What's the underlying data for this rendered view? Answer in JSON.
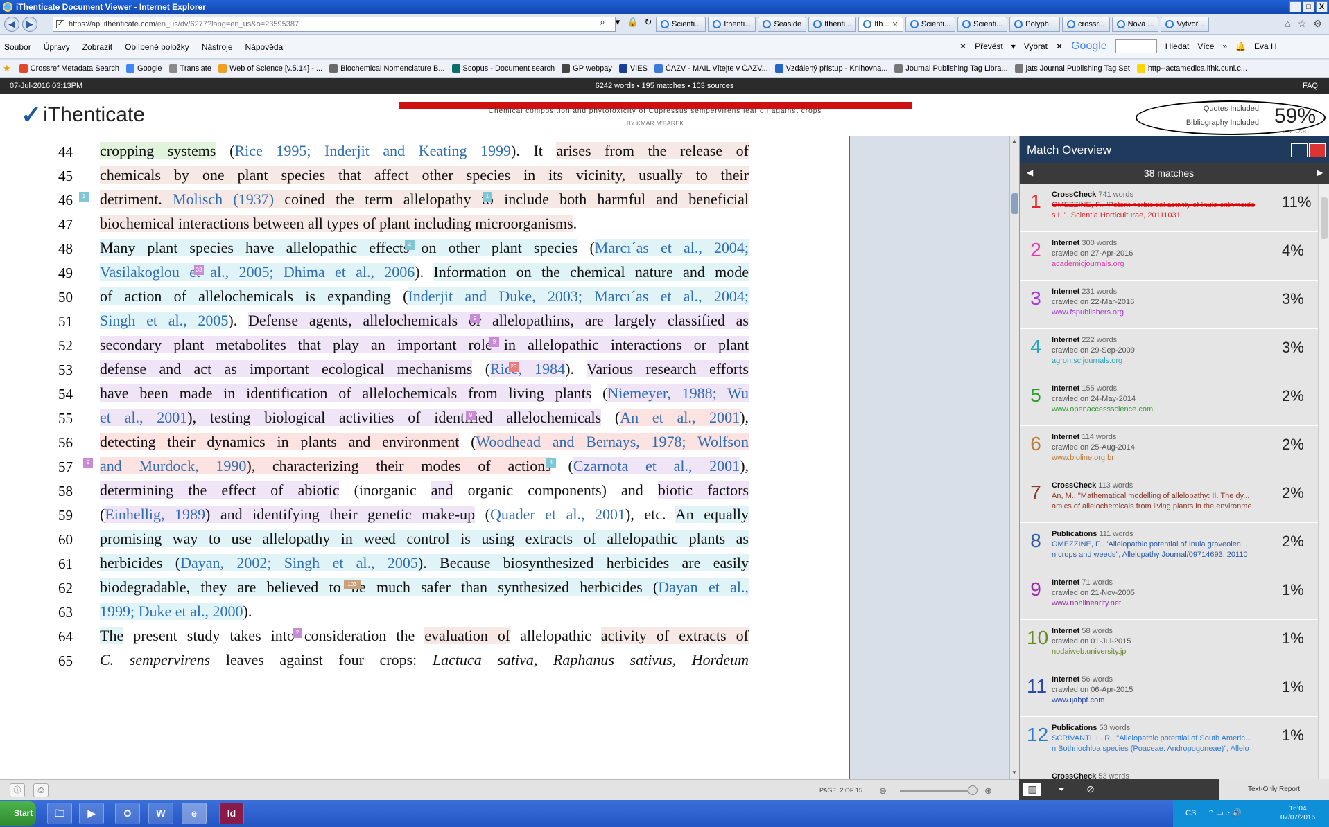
{
  "window": {
    "title": "iThenticate Document Viewer - Internet Explorer",
    "min": "_",
    "max": "□",
    "close": "X"
  },
  "address": {
    "url_main": "https://api.ithenticate.com",
    "url_rest": "/en_us/dv/6277?lang=en_us&o=23595387"
  },
  "tabs": [
    {
      "label": "Scienti..."
    },
    {
      "label": "Ithenti..."
    },
    {
      "label": "Seaside"
    },
    {
      "label": "Ithenti..."
    },
    {
      "label": "Ith..."
    },
    {
      "label": "Scienti..."
    },
    {
      "label": "Scienti..."
    },
    {
      "label": "Polyph..."
    },
    {
      "label": "crossr..."
    },
    {
      "label": "Nová ..."
    },
    {
      "label": "Vytvoř..."
    }
  ],
  "menu": [
    "Soubor",
    "Úpravy",
    "Zobrazit",
    "Oblíbené položky",
    "Nástroje",
    "Nápověda"
  ],
  "commands": {
    "prevest": "Převést",
    "vybrat": "Vybrat",
    "google": "Google",
    "hledat": "Hledat",
    "vice": "Více",
    "user": "Eva H"
  },
  "favorites": [
    {
      "label": "Crossref Metadata Search",
      "color": "#e2472b"
    },
    {
      "label": "Google",
      "color": "#4285f4"
    },
    {
      "label": "Translate",
      "color": "#8a8a8a"
    },
    {
      "label": "Web of Science [v.5.14] - ...",
      "color": "#f0a020"
    },
    {
      "label": "Biochemical Nomenclature B...",
      "color": "#6a6a6a"
    },
    {
      "label": "Scopus - Document search",
      "color": "#0f6d6d"
    },
    {
      "label": "GP webpay",
      "color": "#444444"
    },
    {
      "label": "VIES",
      "color": "#1a3c9a"
    },
    {
      "label": "ČAZV - MAIL  Vítejte v ČAZV...",
      "color": "#3a7bd5"
    },
    {
      "label": "Vzdálený přístup - Knihovna...",
      "color": "#2266cc"
    },
    {
      "label": "Journal Publishing Tag Libra...",
      "color": "#777777"
    },
    {
      "label": "jats Journal Publishing Tag Set",
      "color": "#777777"
    },
    {
      "label": "http--actamedica.lfhk.cuni.c...",
      "color": "#ffd400"
    }
  ],
  "infobar": {
    "date": "07-Jul-2016 03:13PM",
    "stats": "6242 words • 195 matches • 103 sources",
    "faq": "FAQ"
  },
  "header": {
    "logo_text": "iThenticate",
    "doc_title": "Chemical composition and phytotoxicity of Cupressus sempervirens leaf oil against crops",
    "author": "BY KMAR M'BAREK",
    "quotes": "Quotes Included",
    "bibliography": "Bibliography Included",
    "similarity": "59%",
    "similarity_label": "SIMILAR"
  },
  "lines": [
    {
      "n": "44",
      "parts": [
        [
          "cropping systems",
          "green",
          ""
        ],
        [
          " (",
          "",
          ""
        ],
        [
          "Rice 1995; Inderjit and Keating 1999",
          "",
          "cite"
        ],
        [
          "). It ",
          "",
          ""
        ],
        [
          "arises from the release of",
          "pink",
          ""
        ]
      ]
    },
    {
      "n": "45",
      "parts": [
        [
          "chemicals by one plant species that affect other species in its vicinity, usually to their",
          "pink",
          ""
        ]
      ]
    },
    {
      "n": "46",
      "parts": [
        [
          "detriment. ",
          "pink",
          ""
        ],
        [
          "Molisch (1937)",
          "pink",
          "cite"
        ],
        [
          " coined the term allelopathy to include both harmful and beneficial",
          "pink",
          ""
        ]
      ]
    },
    {
      "n": "47",
      "nojust": true,
      "parts": [
        [
          "biochemical interactions between all types of plant including microorganisms",
          "pink",
          ""
        ],
        [
          ".",
          "",
          ""
        ]
      ]
    },
    {
      "n": "48",
      "parts": [
        [
          "Many plant species have allelopathic effects on other plant species",
          "cyan",
          ""
        ],
        [
          " (",
          "",
          ""
        ],
        [
          "Marcı´as et al., 2004;",
          "cyan",
          "cite"
        ]
      ]
    },
    {
      "n": "49",
      "parts": [
        [
          "Vasilakoglou et al., 2005; Dhima et al., 2006",
          "cyan",
          "cite"
        ],
        [
          "). ",
          "",
          ""
        ],
        [
          "Information on the chemical nature and mode",
          "cyan",
          ""
        ]
      ]
    },
    {
      "n": "50",
      "parts": [
        [
          "of action of allelochemicals is expanding",
          "cyan",
          ""
        ],
        [
          " (",
          "",
          ""
        ],
        [
          "Inderjit and Duke, 2003; Marcı´as et al., 2004;",
          "cyan",
          "cite"
        ]
      ]
    },
    {
      "n": "51",
      "parts": [
        [
          "Singh et al., 2005",
          "cyan",
          "cite"
        ],
        [
          "). ",
          "",
          ""
        ],
        [
          "Defense agents, allelochemicals or allelopathins, are largely classified as",
          "lilac",
          ""
        ]
      ]
    },
    {
      "n": "52",
      "parts": [
        [
          "secondary plant metabolites that play an important role in allelopathic interactions or plant",
          "lilac",
          ""
        ]
      ]
    },
    {
      "n": "53",
      "parts": [
        [
          "defense and act as important ecological mechanisms",
          "lilac",
          ""
        ],
        [
          " (",
          "",
          ""
        ],
        [
          "Rice, 1984",
          "lilac",
          "cite"
        ],
        [
          "). ",
          "",
          ""
        ],
        [
          "Various research efforts",
          "lilac",
          ""
        ]
      ]
    },
    {
      "n": "54",
      "parts": [
        [
          "have been made in identification of allelochemicals from living plants",
          "lilac",
          ""
        ],
        [
          " (",
          "",
          ""
        ],
        [
          "Niemeyer, 1988; Wu",
          "lilac",
          "cite"
        ]
      ]
    },
    {
      "n": "55",
      "parts": [
        [
          "et al., 2001",
          "lilac",
          "cite"
        ],
        [
          "), testing biological activities of identified allelochemicals",
          "lilac",
          ""
        ],
        [
          " (",
          "",
          ""
        ],
        [
          "An et al., 2001",
          "red",
          "cite"
        ],
        [
          "),",
          "",
          ""
        ]
      ]
    },
    {
      "n": "56",
      "parts": [
        [
          "detecting their dynamics in plants and environment",
          "red",
          ""
        ],
        [
          " (",
          "",
          ""
        ],
        [
          "Woodhead and Bernays, 1978; Wolfson",
          "red",
          "cite"
        ]
      ]
    },
    {
      "n": "57",
      "parts": [
        [
          "and Murdock, 1990",
          "red",
          "cite"
        ],
        [
          "), characterizing their modes of actions",
          "red",
          ""
        ],
        [
          " (",
          "",
          ""
        ],
        [
          "Czarnota et al., 2001",
          "lilac",
          "cite"
        ],
        [
          "),",
          "",
          ""
        ]
      ]
    },
    {
      "n": "58",
      "parts": [
        [
          "determining the effect of abiotic",
          "lilac",
          ""
        ],
        [
          " (inorganic ",
          "",
          ""
        ],
        [
          "and",
          "lilac",
          ""
        ],
        [
          " organic components) and ",
          "",
          ""
        ],
        [
          "biotic factors",
          "lilac",
          ""
        ]
      ]
    },
    {
      "n": "59",
      "parts": [
        [
          "(",
          "",
          ""
        ],
        [
          "Einhellig, 1989",
          "lilac",
          "cite"
        ],
        [
          ") and identifying their genetic make-up",
          "lilac",
          ""
        ],
        [
          " (",
          "",
          ""
        ],
        [
          "Quader et al., 2001",
          "",
          "cite"
        ],
        [
          "), etc. ",
          "",
          ""
        ],
        [
          "An equally",
          "cyan",
          ""
        ]
      ]
    },
    {
      "n": "60",
      "parts": [
        [
          "promising way to use allelopathy in weed control is using extracts of allelopathic plants as",
          "cyan",
          ""
        ]
      ]
    },
    {
      "n": "61",
      "parts": [
        [
          "herbicides (",
          "cyan",
          ""
        ],
        [
          "Dayan, 2002; Singh et al., 2005",
          "cyan",
          "cite"
        ],
        [
          "). Because biosynthesized herbicides are easily",
          "cyan",
          ""
        ]
      ]
    },
    {
      "n": "62",
      "parts": [
        [
          "biodegradable, they are believed to be much safer than synthesized herbicides (",
          "cyan",
          ""
        ],
        [
          "Dayan et al.,",
          "cyan",
          "cite"
        ]
      ]
    },
    {
      "n": "63",
      "nojust": true,
      "parts": [
        [
          "1999; Duke et al., 2000",
          "cyan",
          "cite"
        ],
        [
          ").",
          "",
          ""
        ]
      ]
    },
    {
      "n": "64",
      "parts": [
        [
          "The",
          "cyan",
          ""
        ],
        [
          " present study takes into consideration the ",
          "",
          ""
        ],
        [
          "evaluation of",
          "pink",
          ""
        ],
        [
          " allelopathic ",
          "",
          ""
        ],
        [
          "activity of extracts of",
          "pink",
          ""
        ]
      ]
    },
    {
      "n": "65",
      "parts": [
        [
          "C. sempervirens",
          "",
          "ital"
        ],
        [
          " leaves against four crops: ",
          "",
          ""
        ],
        [
          "Lactuca sativa, Raphanus sativus, Hordeum",
          "",
          "ital"
        ]
      ]
    }
  ],
  "markers": {
    "m1": "1",
    "m2": "1",
    "m3": "4",
    "m4": "33",
    "m5": "9",
    "m6": "9",
    "m7": "23",
    "m8": "9",
    "m9": "9",
    "m10": "4",
    "m11": "103",
    "m12": "2"
  },
  "panel": {
    "title": "Match Overview",
    "count": "38 matches",
    "prev": "◀",
    "next": "▶"
  },
  "matches": [
    {
      "n": "1",
      "type": "CrossCheck",
      "words": "741 words",
      "line2": "OMEZZINE, F.. \"Potent herbicidal activity of Inula crithmoide",
      "line3": "s L.\", Scientia Horticulturae, 20111031",
      "pct": "11%",
      "color": "#e0262b",
      "strike": true
    },
    {
      "n": "2",
      "type": "Internet",
      "words": "300 words",
      "line2": "crawled on 27-Apr-2016",
      "line3": "academicjournals.org",
      "pct": "4%",
      "color": "#e03ab0"
    },
    {
      "n": "3",
      "type": "Internet",
      "words": "231 words",
      "line2": "crawled on 22-Mar-2016",
      "line3": "www.fspublishers.org",
      "pct": "3%",
      "color": "#a53ad6"
    },
    {
      "n": "4",
      "type": "Internet",
      "words": "222 words",
      "line2": "crawled on 29-Sep-2009",
      "line3": "agron.scijournals.org",
      "pct": "3%",
      "color": "#2aa6b8"
    },
    {
      "n": "5",
      "type": "Internet",
      "words": "155 words",
      "line2": "crawled on 24-May-2014",
      "line3": "www.openaccessscience.com",
      "pct": "2%",
      "color": "#2f9a2f"
    },
    {
      "n": "6",
      "type": "Internet",
      "words": "114 words",
      "line2": "crawled on 25-Aug-2014",
      "line3": "www.bioline.org.br",
      "pct": "2%",
      "color": "#b87a3a"
    },
    {
      "n": "7",
      "type": "CrossCheck",
      "words": "113 words",
      "line2": "An, M.. \"Mathematical modelling of allelopathy: II. The dy...",
      "line3": "amics of allelochemicals from living plants in the environme",
      "pct": "2%",
      "color": "#8a3a2a"
    },
    {
      "n": "8",
      "type": "Publications",
      "words": "111 words",
      "line2": "OMEZZINE, F.. \"Allelopathic potential of Inula graveolen...",
      "line3": "n crops and weeds\", Allelopathy Journal/09714693, 20110",
      "pct": "2%",
      "color": "#2a5aa6"
    },
    {
      "n": "9",
      "type": "Internet",
      "words": "71 words",
      "line2": "crawled on 21-Nov-2005",
      "line3": "www.nonlinearity.net",
      "pct": "1%",
      "color": "#9a2aa6"
    },
    {
      "n": "10",
      "type": "Internet",
      "words": "58 words",
      "line2": "crawled on 01-Jul-2015",
      "line3": "nodaiweb.university.jp",
      "pct": "1%",
      "color": "#6a8a2a"
    },
    {
      "n": "11",
      "type": "Internet",
      "words": "56 words",
      "line2": "crawled on 06-Apr-2015",
      "line3": "www.ijabpt.com",
      "pct": "1%",
      "color": "#2a4aa6"
    },
    {
      "n": "12",
      "type": "Publications",
      "words": "53 words",
      "line2": "SCRIVANTI, L. R.. \"Allelopathic potential of South Americ...",
      "line3": "n Bothriochloa species (Poaceae: Andropogoneae)\", Allelo",
      "pct": "1%",
      "color": "#2a7ad6"
    },
    {
      "n": "",
      "type": "CrossCheck",
      "words": "53 words",
      "line2": "",
      "line3": "",
      "pct": "",
      "color": "#333333"
    }
  ],
  "docbar": {
    "page": "PAGE: 2 OF 15"
  },
  "pbar": {
    "text_only": "Text-Only Report"
  },
  "taskbar": {
    "start": "Start",
    "lang": "CS",
    "time": "16:04",
    "date": "07/07/2016"
  }
}
